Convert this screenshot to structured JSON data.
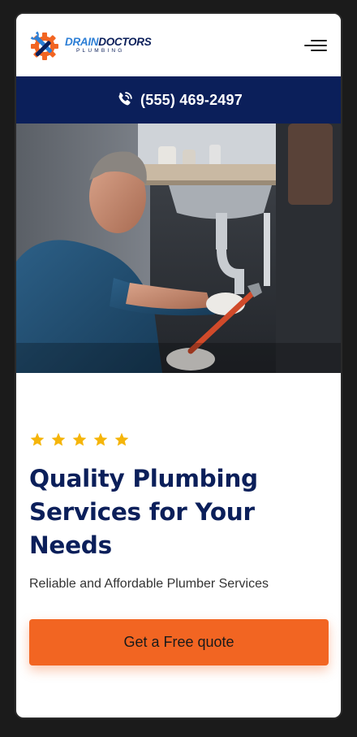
{
  "header": {
    "logo_primary": "DRAIN",
    "logo_secondary": "DOCTORS",
    "logo_tagline": "PLUMBING"
  },
  "phone_bar": {
    "number": "(555) 469-2497"
  },
  "hero": {
    "rating_stars": 5,
    "rating_max": 5
  },
  "main": {
    "title_line1": "Quality Plumbing",
    "title_line2": "Services for Your",
    "title_line3": "Needs",
    "subtitle": "Reliable and Affordable Plumber Services",
    "cta_label": "Get a Free quote"
  },
  "colors": {
    "navy": "#0b1f5a",
    "accent_orange": "#f26522",
    "star_yellow": "#f5b50a",
    "logo_blue": "#2d7fd6"
  },
  "icons": [
    "gear-wrench-logo-icon",
    "hamburger-menu-icon",
    "phone-call-icon",
    "star-icon"
  ]
}
